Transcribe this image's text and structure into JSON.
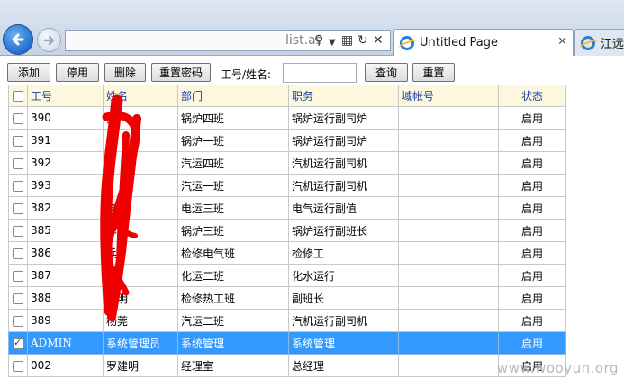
{
  "browser": {
    "address_text": "list.as",
    "tabs": [
      {
        "label": "Untitled Page",
        "active": true,
        "icon": "ie-icon"
      },
      {
        "label": "江远热",
        "active": false,
        "icon": "ie-icon"
      }
    ],
    "close_glyph": "✕"
  },
  "toolbar": {
    "add_label": "添加",
    "disable_label": "停用",
    "delete_label": "删除",
    "reset_password_label": "重置密码",
    "search_label": "工号/姓名:",
    "search_value": "",
    "query_label": "查询",
    "reset_label": "重置"
  },
  "table": {
    "headers": [
      "工号",
      "姓名",
      "部门",
      "职务",
      "域帐号",
      "状态"
    ],
    "rows": [
      {
        "id": "390",
        "name": "豪",
        "dept": "锅炉四班",
        "title": "锅炉运行副司炉",
        "domain_account": "",
        "status": "启用",
        "checked": false,
        "selected": false
      },
      {
        "id": "391",
        "name": "",
        "dept": "锅炉一班",
        "title": "锅炉运行副司炉",
        "domain_account": "",
        "status": "启用",
        "checked": false,
        "selected": false
      },
      {
        "id": "392",
        "name": "",
        "dept": "汽运四班",
        "title": "汽机运行副司机",
        "domain_account": "",
        "status": "启用",
        "checked": false,
        "selected": false
      },
      {
        "id": "393",
        "name": "",
        "dept": "汽运一班",
        "title": "汽机运行副司机",
        "domain_account": "",
        "status": "启用",
        "checked": false,
        "selected": false
      },
      {
        "id": "382",
        "name": "亮",
        "dept": "电运三班",
        "title": "电气运行副值",
        "domain_account": "",
        "status": "启用",
        "checked": false,
        "selected": false
      },
      {
        "id": "385",
        "name": "华",
        "dept": "锅炉三班",
        "title": "锅炉运行副班长",
        "domain_account": "",
        "status": "启用",
        "checked": false,
        "selected": false
      },
      {
        "id": "386",
        "name": "兵",
        "dept": "检修电气班",
        "title": "检修工",
        "domain_account": "",
        "status": "启用",
        "checked": false,
        "selected": false
      },
      {
        "id": "387",
        "name": "陈",
        "dept": "化运二班",
        "title": "化水运行",
        "domain_account": "",
        "status": "启用",
        "checked": false,
        "selected": false
      },
      {
        "id": "388",
        "name": "凤明",
        "dept": "检修热工班",
        "title": "副班长",
        "domain_account": "",
        "status": "启用",
        "checked": false,
        "selected": false
      },
      {
        "id": "389",
        "name": "杨莞",
        "dept": "汽运二班",
        "title": "汽机运行副司机",
        "domain_account": "",
        "status": "启用",
        "checked": false,
        "selected": false
      },
      {
        "id": "ADMIN",
        "name": "系统管理员",
        "dept": "系统管理",
        "title": "系统管理",
        "domain_account": "",
        "status": "启用",
        "checked": true,
        "selected": true
      },
      {
        "id": "002",
        "name": "罗建明",
        "dept": "经理室",
        "title": "总经理",
        "domain_account": "",
        "status": "启用",
        "checked": false,
        "selected": false
      }
    ]
  },
  "colors": {
    "header_bg": "#fcf8de",
    "header_text": "#1d3ea6",
    "selected_row_bg": "#3399ff",
    "redaction_red": "#ee0000"
  },
  "watermark": "www.wooyun.org"
}
